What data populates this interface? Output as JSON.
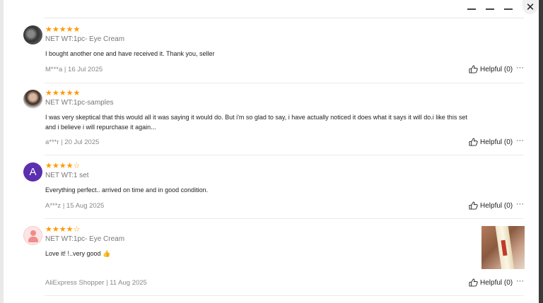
{
  "modal": {
    "close_icon": "close-icon"
  },
  "reviews": [
    {
      "stars": "★★★★★",
      "variant": "NET WT:1pc- Eye Cream",
      "text": "I bought another one and have received it. Thank you, seller",
      "meta": "M***a | 16 Jul 2025",
      "helpful": "Helpful (0)",
      "more": "···"
    },
    {
      "stars": "★★★★★",
      "variant": "NET WT:1pc-samples",
      "text": "I was very skeptical that this would all it was saying it would do. But i'm so glad to say, i have actually noticed it does what it says it will do.i like this set and i believe i will repurchase it again...",
      "meta": "a***r | 20 Jul 2025",
      "helpful": "Helpful (0)",
      "more": "···"
    },
    {
      "avatar_letter": "A",
      "stars_on": "★★★★",
      "stars_off": "☆",
      "variant": "NET WT:1 set",
      "text": "Everything perfect.. arrived on time and in good condition.",
      "meta": "A***z | 15 Aug 2025",
      "helpful": "Helpful (0)",
      "more": "···"
    },
    {
      "stars_on": "★★★★",
      "stars_off": "☆",
      "variant": "NET WT:1pc- Eye Cream",
      "text": "Love it! !..very good 👍",
      "meta": "AliExpress Shopper | 11 Aug 2025",
      "helpful": "Helpful (0)",
      "more": "···"
    }
  ],
  "colors": {
    "star": "#ff9900",
    "avatar_letter_bg": "#5b2fb0"
  }
}
